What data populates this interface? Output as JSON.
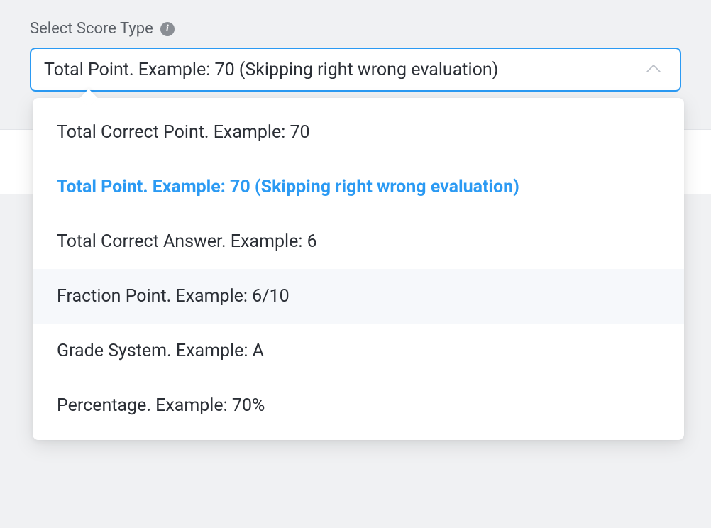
{
  "field": {
    "label": "Select Score Type",
    "info_tooltip": "i"
  },
  "select": {
    "selected_value": "Total Point. Example: 70 (Skipping right wrong evaluation)",
    "selected_index": 1,
    "hovered_index": 3,
    "options": [
      {
        "label": "Total Correct Point. Example: 70"
      },
      {
        "label": "Total Point. Example: 70 (Skipping right wrong evaluation)"
      },
      {
        "label": "Total Correct Answer. Example: 6"
      },
      {
        "label": "Fraction Point. Example: 6/10"
      },
      {
        "label": "Grade System. Example: A"
      },
      {
        "label": "Percentage. Example: 70%"
      }
    ]
  }
}
